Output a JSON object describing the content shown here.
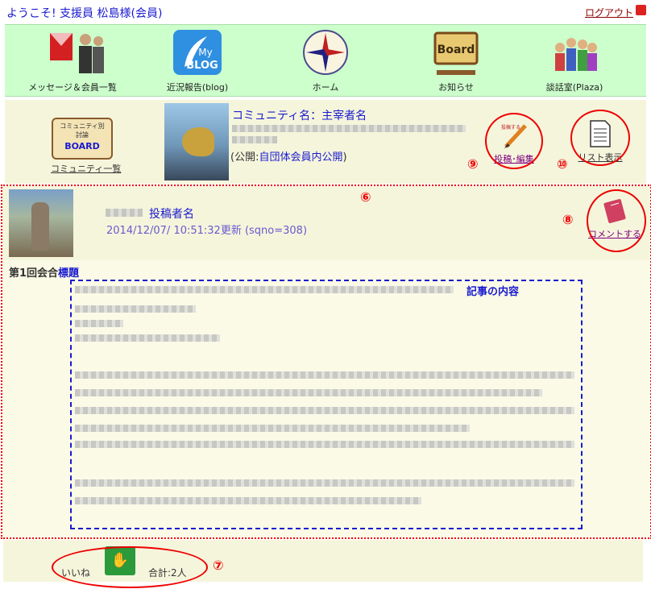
{
  "header": {
    "welcome": "ようこそ! 支援員 松島様(会員)",
    "logout": "ログアウト"
  },
  "nav": [
    {
      "label": "メッセージ＆会員一覧",
      "icon": "message-icon"
    },
    {
      "label": "近況報告(blog)",
      "icon": "blog-icon",
      "icon_text_1": "My",
      "icon_text_2": "BLOG"
    },
    {
      "label": "ホーム",
      "icon": "compass-icon"
    },
    {
      "label": "お知らせ",
      "icon": "board-icon",
      "icon_text": "Board"
    },
    {
      "label": "談話室(Plaza)",
      "icon": "people-icon"
    }
  ],
  "community": {
    "board_line1": "コミュニティ別",
    "board_line2": "討論",
    "board_word": "BOARD",
    "list_link": "コミュニティ一覧",
    "name": "コミュニティ名：主宰者名",
    "public_open": "(公開:",
    "public_scope": "自団体会員内公開",
    "public_close": ")",
    "post_edit": "投稿･編集",
    "post_icon_text": "投稿する",
    "list_view": "リスト表示"
  },
  "post": {
    "poster": "投稿者名",
    "updated": "2014/12/07/ 10:51:32更新 (sqno=308)",
    "comment": "コメントする",
    "title_prefix": "第1回会合",
    "title": "標題",
    "content_label": "記事の内容"
  },
  "like": {
    "label": "いいね",
    "total": "合計:2人"
  },
  "annotations": {
    "n6": "⑥",
    "n7": "⑦",
    "n8": "⑧",
    "n9": "⑨",
    "n10": "⑩"
  },
  "colors": {
    "accent_red": "#e00000",
    "link_blue": "#1a1ad0",
    "nav_bg": "#ccffcc",
    "panel_bg": "#f5f5dc"
  }
}
